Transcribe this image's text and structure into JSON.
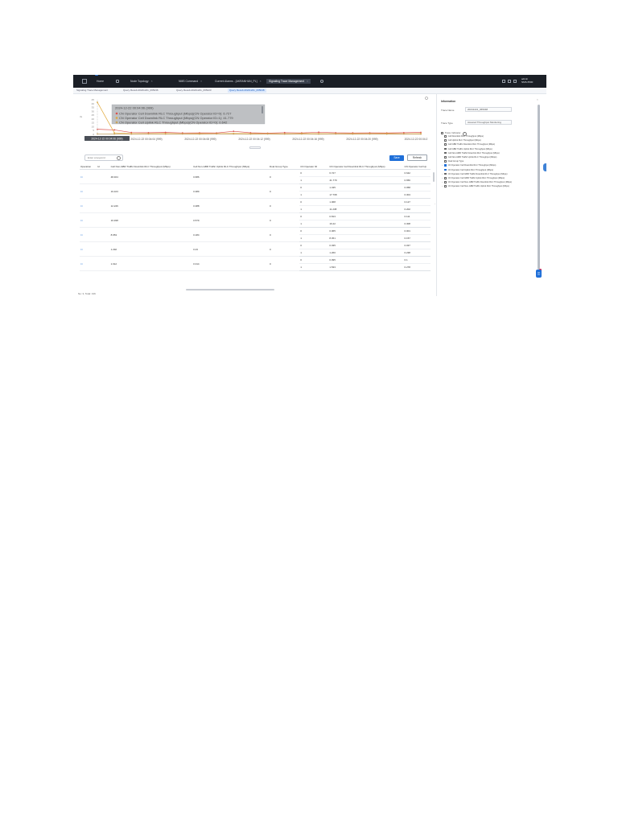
{
  "topbar": {
    "tabs": [
      {
        "label": "Home",
        "active": false
      },
      {
        "label": "Node Topology",
        "active": false
      },
      {
        "label": "NMS Command",
        "active": false
      },
      {
        "label": "Current Alarms - [AKRANHUN_PL]",
        "active": false
      },
      {
        "label": "Signaling Trace Management",
        "active": true
      }
    ],
    "user_line1": "admin",
    "user_line2": "NMS-5500"
  },
  "subtabs": [
    {
      "label": "Signaling Trace Management",
      "active": false
    },
    {
      "label": "Query Result-20241221_065236",
      "active": false
    },
    {
      "label": "Query Result-20241221_065223",
      "active": false
    },
    {
      "label": "Query Result-20241221_065048",
      "active": true
    }
  ],
  "chart": {
    "tooltip": {
      "title": "2024-12-22 00:04:06 (999)",
      "lines": [
        "CN Operator Cell Downlink RLC Throughput (Mbps)(CN Operator ID=0): 6.727",
        "CN Operator Cell Downlink RLC Throughput (Mbps)(CN Operator ID=1): 41.779",
        "CN Operator Cell Uplink RLC Throughput (Mbps)(CN Operator ID=0): 0.642"
      ]
    },
    "cursor_label": "2024-12-22 00:04:06 (999)",
    "side_label": "3s",
    "xticks": [
      "2024-12-22 00:04:06 (999)",
      "2024-12-22 00:04:04 (999)",
      "2024-12-22 00:04:08 (999)",
      "2024-12-22 00:04:12 (999)",
      "2024-12-22 00:04:16 (999)",
      "2024-12-22 00:04:20 (999)",
      "2024-12-22 00:04:2"
    ],
    "yticks": [
      "45",
      "40",
      "35",
      "30",
      "25",
      "20",
      "15",
      "10",
      "5",
      "0"
    ]
  },
  "chart_data": {
    "type": "line",
    "ylim": [
      0,
      45
    ],
    "x": [
      "00:04:00",
      "00:04:02",
      "00:04:04",
      "00:04:06",
      "00:04:08",
      "00:04:10",
      "00:04:12",
      "00:04:14",
      "00:04:16",
      "00:04:18",
      "00:04:20",
      "00:04:22",
      "00:04:24",
      "00:04:26",
      "00:04:28",
      "00:04:30",
      "00:04:32",
      "00:04:34",
      "00:04:36",
      "00:04:38"
    ],
    "series": [
      {
        "name": "CN Operator Cell Downlink RLC Throughput (Mbps)(CN Operator ID=0)",
        "color": "#d9534f",
        "values": [
          6.7,
          5.8,
          2.4,
          2.2,
          2.6,
          1.9,
          2.0,
          1.8,
          4.0,
          2.1,
          1.6,
          2.3,
          1.9,
          2.8,
          2.1,
          1.9,
          2.0,
          1.8,
          2.2,
          2.6
        ]
      },
      {
        "name": "CN Operator Cell Downlink RLC Throughput (Mbps)(CN Operator ID=1)",
        "color": "#e0a83a",
        "values": [
          41.8,
          2.0,
          1.0,
          0.9,
          1.1,
          0.8,
          0.9,
          1.0,
          1.2,
          0.9,
          1.0,
          0.8,
          1.1,
          0.9,
          1.0,
          0.9,
          1.0,
          1.1,
          0.8,
          1.0
        ]
      },
      {
        "name": "CN Operator Cell Uplink RLC Throughput (Mbps)(CN Operator ID=0)",
        "color": "#c8a25a",
        "values": [
          0.6,
          0.5,
          0.4,
          0.5,
          0.4,
          0.5,
          0.4,
          0.6,
          0.5,
          0.4,
          0.5,
          0.4,
          0.5,
          0.4,
          0.5,
          0.4,
          0.5,
          0.4,
          0.5,
          0.4
        ]
      }
    ]
  },
  "table": {
    "search_placeholder": "Enter a keyword",
    "save_label": "Save",
    "refresh_label": "Refresh",
    "columns": [
      "Operation",
      "Id",
      "Cell Non-GBR Traffic Downlink RLC Throughput (Mbps)",
      "Cell Non-GBR Traffic Uplink RLC Throughput (Mbps)",
      "Dual Group Type",
      "CN Operator ID",
      "CN Operator Cell Downlink RLC Throughput (Mbps)",
      "CN Operator Cell Up"
    ],
    "rows": [
      {
        "dl": "48.464",
        "ul": "0.686",
        "group": "0",
        "ops": [
          {
            "id": "0",
            "dl": "6.727",
            "ul": "0.642"
          },
          {
            "id": "1",
            "dl": "41.779",
            "ul": "0.656"
          }
        ]
      },
      {
        "dl": "19.103",
        "ul": "0.389",
        "group": "0",
        "ops": [
          {
            "id": "0",
            "dl": "1.435",
            "ul": "0.058"
          },
          {
            "id": "1",
            "dl": "17.768",
            "ul": "0.304"
          }
        ]
      },
      {
        "dl": "12.246",
        "ul": "0.388",
        "group": "0",
        "ops": [
          {
            "id": "0",
            "dl": "1.068",
            "ul": "0.127"
          },
          {
            "id": "1",
            "dl": "11.238",
            "ul": "0.202"
          }
        ]
      },
      {
        "dl": "16.938",
        "ul": "0.579",
        "group": "0",
        "ops": [
          {
            "id": "0",
            "dl": "0.813",
            "ul": "0.111"
          },
          {
            "id": "1",
            "dl": "16.22",
            "ul": "0.308"
          }
        ]
      },
      {
        "dl": "8.653",
        "ul": "0.184",
        "group": "0",
        "ops": [
          {
            "id": "0",
            "dl": "0.065",
            "ul": "0.001"
          },
          {
            "id": "1",
            "dl": "8.451",
            "ul": "0.157"
          }
        ]
      },
      {
        "dl": "1.292",
        "ul": "0.23",
        "group": "0",
        "ops": [
          {
            "id": "0",
            "dl": "0.035",
            "ul": "0.037"
          },
          {
            "id": "1",
            "dl": "1.260",
            "ul": "0.238"
          }
        ]
      },
      {
        "dl": "1.612",
        "ul": "0.314",
        "group": "0",
        "ops": [
          {
            "id": "0",
            "dl": "0.095",
            "ul": "0.1"
          },
          {
            "id": "1",
            "dl": "1.533",
            "ul": "0.278"
          }
        ]
      }
    ],
    "footer": "No: 3,  Total: 316"
  },
  "info": {
    "title": "Information",
    "trace_name_label": "Trace Name",
    "trace_name_value": "20241221_065048",
    "trace_type_label": "Trace Type",
    "trace_type_value": "Assured Throughput Monitoring",
    "indicator_label": "Trace Indicator",
    "indicators": [
      {
        "label": "Cell Downlink RLC Throughput (Mbps)",
        "checked": false,
        "expander": false
      },
      {
        "label": "Cell Uplink RLC Throughput (Mbps)",
        "checked": false,
        "expander": false
      },
      {
        "label": "Cell GBR Traffic Downlink RLC Throughput (Mbps)",
        "checked": false,
        "expander": false
      },
      {
        "label": "Cell GBR Traffic Uplink RLC Throughput (Mbps)",
        "checked": false,
        "expander": false
      },
      {
        "label": "Cell Non-GBR Traffic Downlink RLC Throughput (Mbps)",
        "checked": false,
        "expander": false
      },
      {
        "label": "Cell Non-GBR Traffic Uplink RLC Throughput (Mbps)",
        "checked": false,
        "expander": false
      },
      {
        "label": "Dual Group Type",
        "checked": false,
        "expander": false
      },
      {
        "label": "CN Operator Cell Downlink RLC Throughput (Mbps)",
        "checked": true,
        "expander": true
      },
      {
        "label": "CN Operator Cell Uplink RLC Throughput (Mbps)",
        "checked": true,
        "expander": false
      },
      {
        "label": "CN Operator Cell GBR Traffic Downlink RLC Throughput (Mbps)",
        "checked": false,
        "expander": true
      },
      {
        "label": "CN Operator Cell GBR Traffic Uplink RLC Throughput (Mbps)",
        "checked": false,
        "expander": true
      },
      {
        "label": "CN Operator Cell Non-GBR Traffic Downlink RLC Throughput (Mbps)",
        "checked": false,
        "expander": true
      },
      {
        "label": "CN Operator Cell Non-GBR Traffic Uplink RLC Throughput (Mbps)",
        "checked": false,
        "expander": true
      }
    ]
  }
}
